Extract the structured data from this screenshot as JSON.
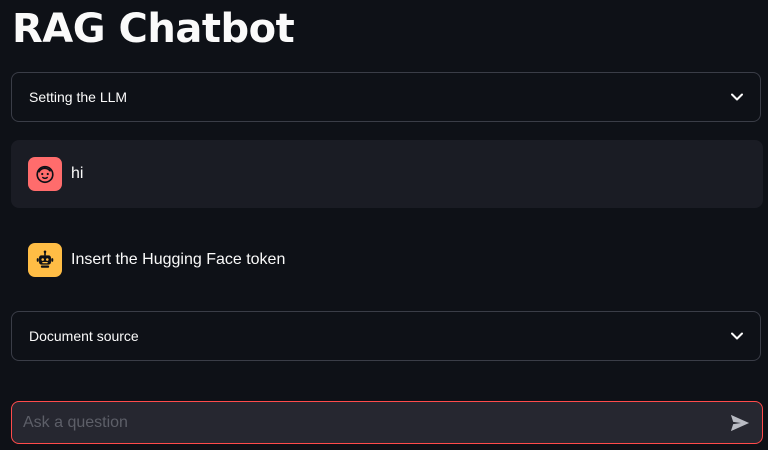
{
  "page": {
    "title": "RAG Chatbot"
  },
  "expanders": {
    "llm_settings": {
      "label": "Setting the LLM",
      "icon": "chevron-down-icon"
    },
    "document_source": {
      "label": "Document source",
      "icon": "chevron-down-icon"
    }
  },
  "chat": {
    "messages": [
      {
        "role": "user",
        "avatar_icon": "user-face-icon",
        "text": "hi"
      },
      {
        "role": "assistant",
        "avatar_icon": "robot-icon",
        "text": "Insert the Hugging Face token"
      }
    ]
  },
  "chat_input": {
    "placeholder": "Ask a question",
    "value": "",
    "send_icon": "send-icon"
  },
  "colors": {
    "background": "#0e1117",
    "user_message_bg": "#1a1c24",
    "user_avatar": "#ff6c6c",
    "assistant_avatar": "#ffbd45",
    "input_border_focus": "#ff4b4b",
    "input_bg": "#262730",
    "text": "#fafafa"
  }
}
